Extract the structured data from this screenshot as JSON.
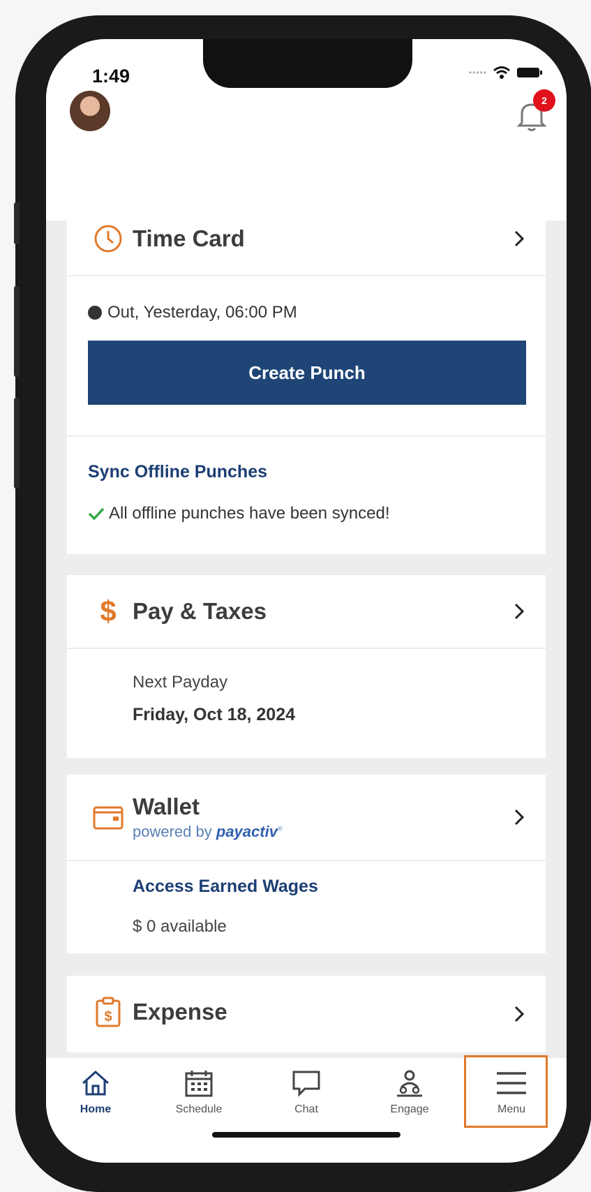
{
  "status_bar": {
    "time": "1:49"
  },
  "header": {
    "notification_count": "2"
  },
  "time_card": {
    "title": "Time Card",
    "status": "Out, Yesterday, 06:00 PM",
    "create_punch_label": "Create Punch",
    "sync_title": "Sync Offline Punches",
    "sync_status": "All offline punches have been synced!"
  },
  "pay_taxes": {
    "title": "Pay & Taxes",
    "next_payday_label": "Next Payday",
    "next_payday_date": "Friday, Oct 18, 2024"
  },
  "wallet": {
    "title": "Wallet",
    "powered_by": "powered by",
    "brand": "payactiv",
    "access_label": "Access Earned Wages",
    "available": "$ 0 available"
  },
  "expense": {
    "title": "Expense"
  },
  "bottom_nav": {
    "items": [
      {
        "label": "Home",
        "icon": "home-icon"
      },
      {
        "label": "Schedule",
        "icon": "calendar-icon"
      },
      {
        "label": "Chat",
        "icon": "chat-icon"
      },
      {
        "label": "Engage",
        "icon": "engage-icon"
      },
      {
        "label": "Menu",
        "icon": "menu-icon"
      }
    ]
  },
  "colors": {
    "accent": "#e07a2b",
    "primary": "#1e4576",
    "link": "#1d3f74",
    "badge": "#e0111b"
  }
}
